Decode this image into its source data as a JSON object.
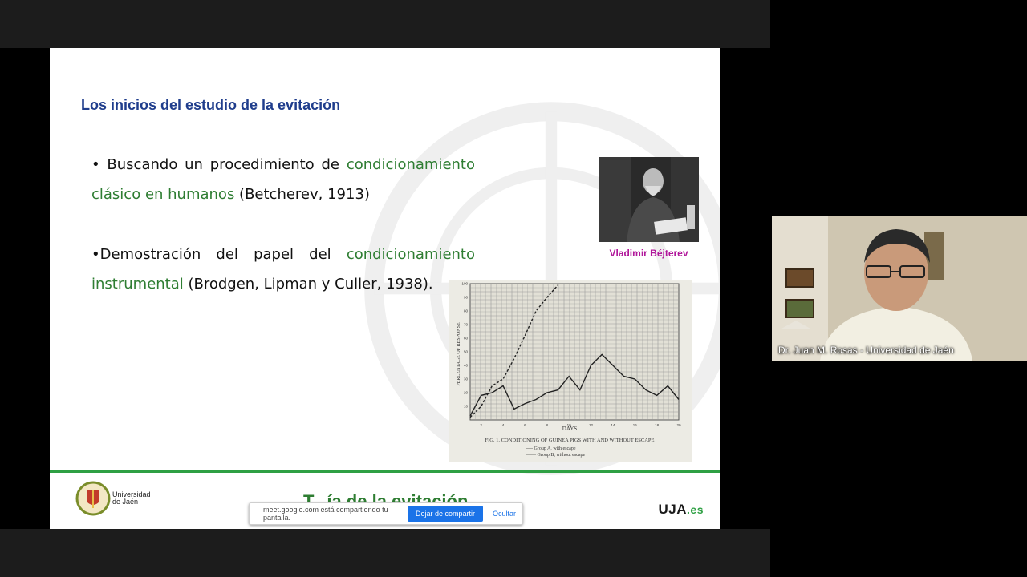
{
  "slide": {
    "title": "Los inicios del estudio de la evitación",
    "bullet1": {
      "prefix": "• Buscando un procedimiento de ",
      "highlight": "condicionamiento clásico en humanos",
      "suffix": " (Betcherev, 1913)"
    },
    "bullet2": {
      "prefix": "•Demostración del papel del ",
      "highlight": "condicionamiento instrumental",
      "suffix": " (Brodgen, Lipman y Culler, 1938)."
    },
    "photo_caption": "Vladimir Béjterev",
    "figure": {
      "ylabel": "PERCENTAGE OF RESPONSE",
      "xlabel": "DAYS",
      "caption": "FIG. 1. CONDITIONING OF GUINEA PIGS WITH AND WITHOUT ESCAPE",
      "legend_a": "---- Group A, with escape",
      "legend_b": "—— Group B, without escape"
    },
    "footer": {
      "university_line1": "Universidad",
      "university_line2": "de Jaén",
      "title_partial": "T...ía de la evitación",
      "brand_main": "UJA",
      "brand_suffix": ".es"
    }
  },
  "share_bar": {
    "message": "meet.google.com está compartiendo tu pantalla.",
    "stop_label": "Dejar de compartir",
    "hide_label": "Ocultar"
  },
  "participant": {
    "name": "Dr. Juan M. Rosas - Universidad de Jaén"
  },
  "chart_data": {
    "type": "line",
    "title": "",
    "xlabel": "DAYS",
    "ylabel": "PERCENTAGE OF RESPONSE",
    "x": [
      1,
      2,
      3,
      4,
      5,
      6,
      7,
      8,
      9,
      10,
      11,
      12,
      13,
      14,
      15,
      16,
      17,
      18,
      19,
      20
    ],
    "ylim": [
      0,
      100
    ],
    "series": [
      {
        "name": "Group A, with escape",
        "x": [
          1,
          2,
          3,
          4,
          5,
          6,
          7,
          8,
          9
        ],
        "values": [
          2,
          10,
          25,
          30,
          45,
          62,
          80,
          90,
          99
        ]
      },
      {
        "name": "Group B, without escape",
        "values": [
          3,
          18,
          20,
          25,
          8,
          12,
          15,
          20,
          22,
          32,
          22,
          40,
          48,
          40,
          32,
          30,
          22,
          18,
          25,
          15
        ]
      }
    ]
  }
}
